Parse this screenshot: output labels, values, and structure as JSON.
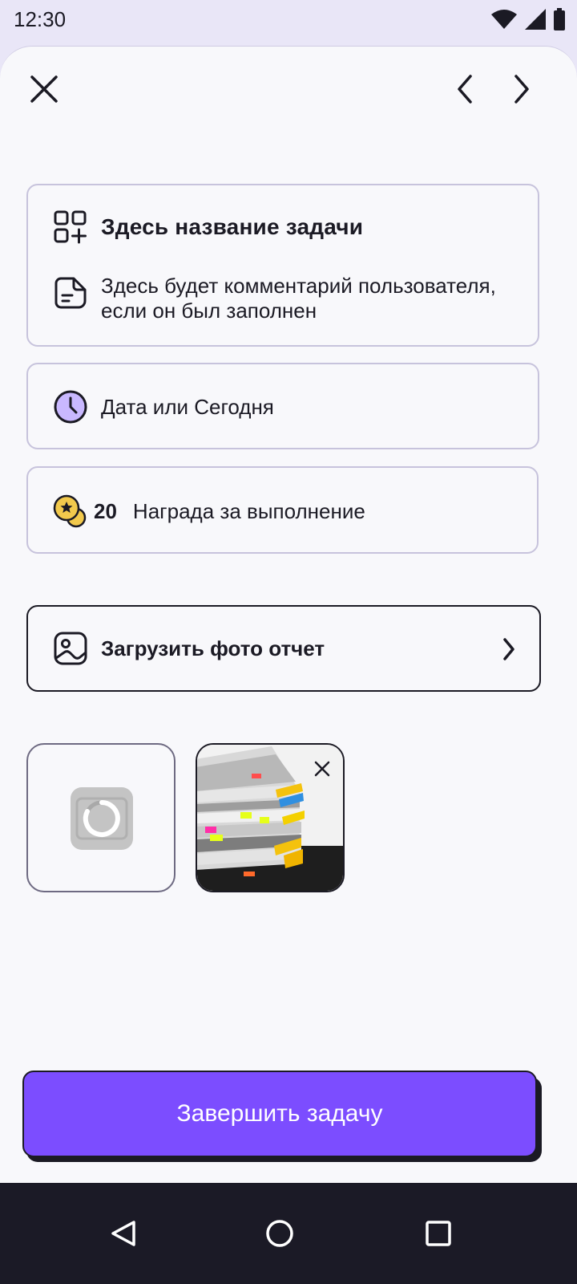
{
  "status_bar": {
    "time": "12:30",
    "icons": [
      "wifi-icon",
      "signal-icon",
      "battery-icon"
    ]
  },
  "header": {
    "icons": [
      "close-icon",
      "chevron-left-icon",
      "chevron-right-icon"
    ]
  },
  "task": {
    "title": "Здесь название задачи",
    "comment": "Здесь будет комментарий пользователя, если он был заполнен",
    "date": "Дата или Сегодня",
    "reward_amount": "20",
    "reward_label": "Награда за выполнение"
  },
  "upload": {
    "label": "Загрузить фото отчет"
  },
  "photos": [
    {
      "state": "loading"
    },
    {
      "state": "loaded"
    }
  ],
  "actions": {
    "complete_label": "Завершить задачу"
  },
  "colors": {
    "accent": "#7c4dff",
    "sheet_bg": "#f8f8fb",
    "status_bg": "#e9e6f7",
    "card_border": "#c7c3dc",
    "clock_fill": "#c9b8ff",
    "coin": "#f2c94c"
  }
}
